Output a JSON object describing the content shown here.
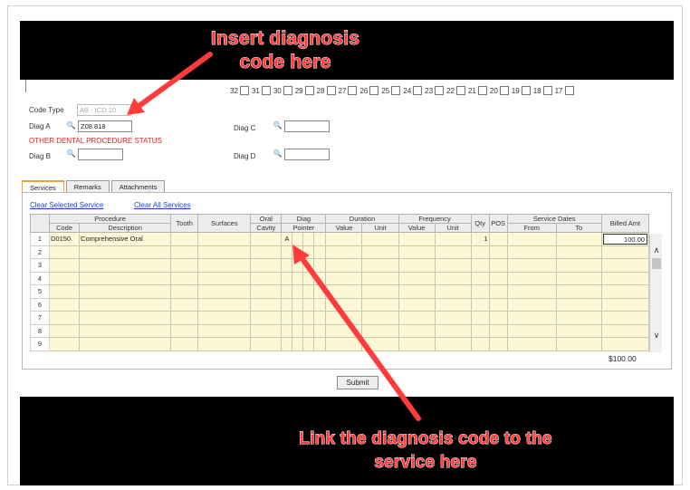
{
  "callouts": {
    "top_line1": "Insert diagnosis",
    "top_line2": "code here",
    "bottom_line1": "Link the diagnosis code to the",
    "bottom_line2": "service here"
  },
  "teeth": [
    "32",
    "31",
    "30",
    "29",
    "28",
    "27",
    "26",
    "25",
    "24",
    "23",
    "22",
    "21",
    "20",
    "19",
    "18",
    "17"
  ],
  "diagnosis": {
    "code_type_label": "Code Type",
    "code_type_value": "AB - ICD 10",
    "diag_a_label": "Diag A",
    "diag_a_value": "Z08.818",
    "diag_b_label": "Diag B",
    "diag_b_value": "",
    "diag_c_label": "Diag C",
    "diag_c_value": "",
    "diag_d_label": "Diag D",
    "diag_d_value": "",
    "status_text": "OTHER DENTAL PROCEDURE STATUS",
    "lookup_icon": "magnifier-icon"
  },
  "tabs": [
    "Services",
    "Remarks",
    "Attachments"
  ],
  "links": {
    "clear_selected": "Clear Selected Service",
    "clear_all": "Clear All Services"
  },
  "grid": {
    "group_headers": {
      "procedure": "Procedure",
      "tooth": "Tooth",
      "surfaces": "Surfaces",
      "oral1": "Oral",
      "oral2": "Cavity",
      "diag1": "Diag",
      "diag2": "Pointer",
      "duration": "Duration",
      "frequency": "Frequency",
      "qty": "Qty",
      "pos": "POS",
      "service_dates": "Service Dates",
      "billed": "Billed Amt"
    },
    "sub_headers": {
      "code": "Code",
      "description": "Description",
      "dur_value": "Value",
      "dur_unit": "Unit",
      "freq_value": "Value",
      "freq_unit": "Unit",
      "from": "From",
      "to": "To"
    },
    "rows": [
      {
        "n": "1",
        "code": "D0150",
        "description": "Comprehensive Oral",
        "pointer": "A",
        "qty": "1",
        "billed": "100.00"
      },
      {
        "n": "2",
        "code": "",
        "description": "",
        "pointer": "",
        "qty": "",
        "billed": ""
      },
      {
        "n": "3",
        "code": "",
        "description": "",
        "pointer": "",
        "qty": "",
        "billed": ""
      },
      {
        "n": "4",
        "code": "",
        "description": "",
        "pointer": "",
        "qty": "",
        "billed": ""
      },
      {
        "n": "5",
        "code": "",
        "description": "",
        "pointer": "",
        "qty": "",
        "billed": ""
      },
      {
        "n": "6",
        "code": "",
        "description": "",
        "pointer": "",
        "qty": "",
        "billed": ""
      },
      {
        "n": "7",
        "code": "",
        "description": "",
        "pointer": "",
        "qty": "",
        "billed": ""
      },
      {
        "n": "8",
        "code": "",
        "description": "",
        "pointer": "",
        "qty": "",
        "billed": ""
      },
      {
        "n": "9",
        "code": "",
        "description": "",
        "pointer": "",
        "qty": "",
        "billed": ""
      }
    ]
  },
  "total": "$100.00",
  "submit_label": "Submit",
  "colors": {
    "callout": "#ff3b3b",
    "row_fill": "#fdf7d5",
    "link": "#1a46c2",
    "warning": "#e02020"
  }
}
